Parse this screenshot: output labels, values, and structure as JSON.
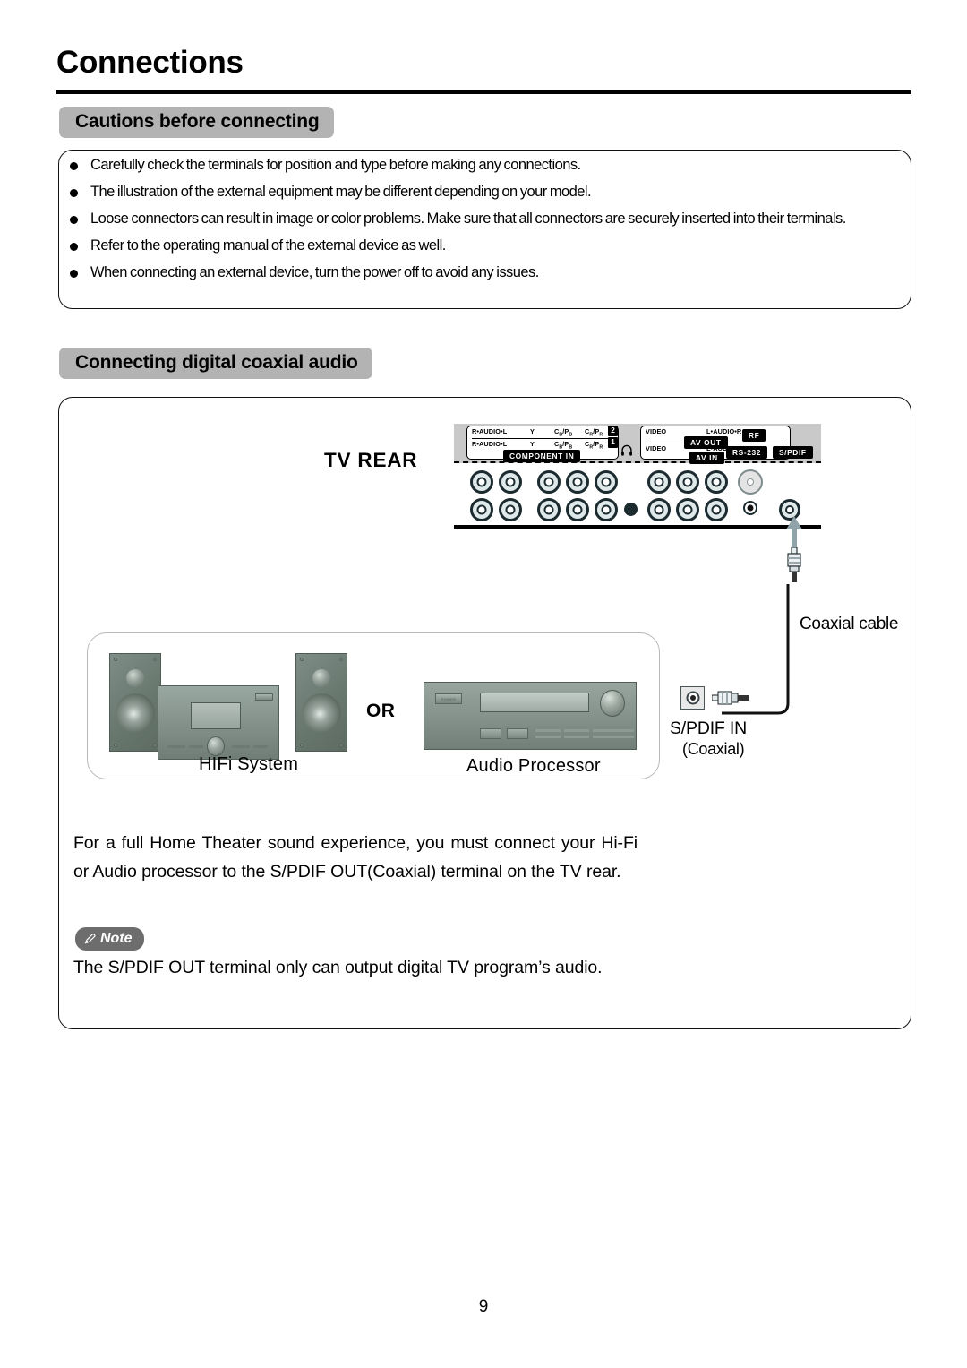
{
  "page": {
    "title": "Connections",
    "number": "9"
  },
  "sections": {
    "cautions": {
      "heading": "Cautions before connecting",
      "bullets": [
        "Carefully check the terminals for position and type before making any connections.",
        "The illustration of the external equipment may be different depending on your model.",
        "Loose connectors can result in image or color problems. Make sure that all connectors are securely inserted into their terminals.",
        "Refer to the operating manual of the external device as well.",
        "When connecting an external device, turn the power off to avoid any issues."
      ]
    },
    "coaxial": {
      "heading": "Connecting digital coaxial audio",
      "tv_rear_label": "TV REAR",
      "panel": {
        "component_group": {
          "row2": {
            "audio": "R•AUDIO•L",
            "y": "Y",
            "cb": "C",
            "cb_sub": "B",
            "cb_slash": "/P",
            "cb_sub2": "B",
            "cr": "C",
            "cr_sub": "R",
            "cr_slash": "/P",
            "cr_sub2": "R",
            "index": "2"
          },
          "row1": {
            "audio": "R•AUDIO•L",
            "y": "Y",
            "index": "1"
          },
          "caption": "COMPONENT IN"
        },
        "av_group": {
          "video": "VIDEO",
          "audio": "L•AUDIO•R",
          "out_caption": "AV OUT",
          "in_caption": "AV IN"
        },
        "rf": "RF",
        "rs232": "RS-232",
        "spdif": "S/PDIF",
        "headphone_icon": "headphone-icon"
      },
      "cable_label": "Coaxial cable",
      "spdif_in_label": "S/PDIF IN",
      "spdif_in_sub": "(Coaxial)",
      "equipment": {
        "hifi_caption": "HIFi  System",
        "or_label": "OR",
        "processor_caption": "Audio  Processor",
        "power_label": "POWER"
      },
      "paragraph": "For a full Home Theater sound experience, you must connect your Hi-Fi or Audio processor to the S/PDIF OUT(Coaxial) terminal on the TV rear.",
      "note": {
        "badge": "Note",
        "text": "The S/PDIF OUT terminal only can output digital TV program’s audio."
      }
    }
  },
  "colors": {
    "pill_gray": "#b3b3b3",
    "note_gray": "#6d6d6d",
    "panel_gray": "#c9c9c9",
    "arrow_slate": "#8fa3a8",
    "equipment_green": "#6f7d76"
  }
}
